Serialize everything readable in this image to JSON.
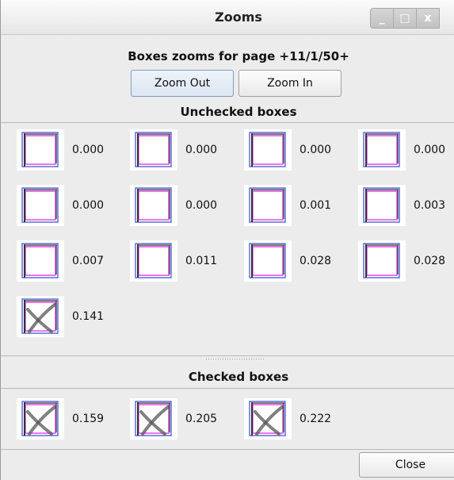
{
  "window": {
    "title": "Zooms",
    "controls": {
      "minimize": "_",
      "maximize": "□",
      "close": "x"
    }
  },
  "header": {
    "caption": "Boxes zooms for page +11/1/50+"
  },
  "toolbar": {
    "zoom_out_label": "Zoom Out",
    "zoom_in_label": "Zoom In"
  },
  "unchecked": {
    "heading": "Unchecked boxes",
    "items": [
      {
        "value": "0.000",
        "checked": false
      },
      {
        "value": "0.000",
        "checked": false
      },
      {
        "value": "0.000",
        "checked": false
      },
      {
        "value": "0.000",
        "checked": false
      },
      {
        "value": "0.000",
        "checked": false
      },
      {
        "value": "0.000",
        "checked": false
      },
      {
        "value": "0.001",
        "checked": false
      },
      {
        "value": "0.003",
        "checked": false
      },
      {
        "value": "0.007",
        "checked": false
      },
      {
        "value": "0.011",
        "checked": false
      },
      {
        "value": "0.028",
        "checked": false
      },
      {
        "value": "0.028",
        "checked": false
      },
      {
        "value": "0.141",
        "checked": true
      }
    ]
  },
  "checked": {
    "heading": "Checked boxes",
    "items": [
      {
        "value": "0.159",
        "checked": true
      },
      {
        "value": "0.205",
        "checked": true
      },
      {
        "value": "0.222",
        "checked": true
      }
    ]
  },
  "footer": {
    "close_label": "Close"
  },
  "colors": {
    "box_outline_blue": "#5b6fd8",
    "box_outline_magenta": "#e04ce0",
    "box_stroke_dark": "#333333",
    "cross_gray": "#555555"
  }
}
